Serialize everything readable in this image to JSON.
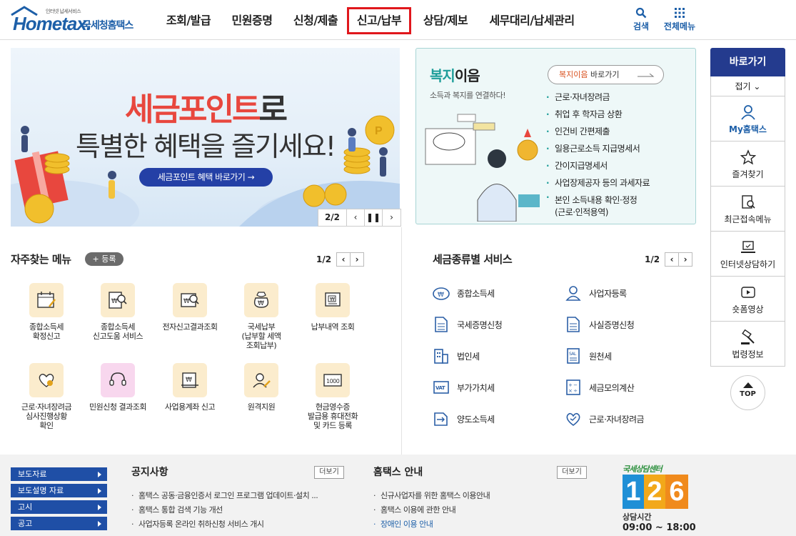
{
  "header": {
    "logo_small": "인터넷 납세서비스",
    "logo_word": "Hometax.",
    "logo_kr": "국세청홈택스",
    "nav": [
      "조회/발급",
      "민원증명",
      "신청/제출",
      "신고/납부",
      "상담/제보",
      "세무대리/납세관리"
    ],
    "active_nav": "신고/납부",
    "search_label": "검색",
    "allmenu_label": "전체메뉴"
  },
  "banner": {
    "title_red": "세금포인트",
    "title_rest": "로",
    "subtitle": "특별한 혜택을 즐기세요!",
    "cta": "세금포인트 혜택 바로가기 →",
    "page": "2/2"
  },
  "welfare": {
    "title_accent": "복지",
    "title_rest": "이음",
    "subtitle": "소득과 복지를 연결하다!",
    "button_accent": "복지이음",
    "button_rest": " 바로가기",
    "items": [
      "근로·자녀장려금",
      "취업 후 학자금 상환",
      "인건비 간편제출",
      "일용근로소득 지급명세서",
      "간이지급명세서",
      "사업장제공자 등의 과세자료",
      "본인 소득내용 확인·정정",
      "(근로·인적용역)"
    ]
  },
  "quick": {
    "title": "바로가기",
    "fold": "접기",
    "items": [
      "My홈택스",
      "즐겨찾기",
      "최근접속메뉴",
      "인터넷상담하기",
      "숏폼영상",
      "법령정보"
    ],
    "top": "TOP"
  },
  "frequent": {
    "title": "자주찾는 메뉴",
    "register": "+ 등록",
    "page": "1/2",
    "items": [
      {
        "label": "종합소득세\n확정신고",
        "icon": "calendar-icon"
      },
      {
        "label": "종합소득세\n신고도움 서비스",
        "icon": "doc-search-icon"
      },
      {
        "label": "전자신고결과조회",
        "icon": "doc-search-icon"
      },
      {
        "label": "국세납부\n(납부할 세액\n조회납부)",
        "icon": "money-bag-icon"
      },
      {
        "label": "납부내역 조회",
        "icon": "receipt-icon"
      },
      {
        "label": "근로·자녀장려금\n심사진행상황\n확인",
        "icon": "heart-hand-icon"
      },
      {
        "label": "민원신청 결과조회",
        "icon": "headset-icon"
      },
      {
        "label": "사업용계좌 신고",
        "icon": "bankbook-icon"
      },
      {
        "label": "원격지원",
        "icon": "support-icon"
      },
      {
        "label": "현금영수증\n발급용 휴대전화\n및 카드 등록",
        "icon": "card-icon"
      }
    ]
  },
  "taxservice": {
    "title": "세금종류별 서비스",
    "page": "1/2",
    "items": [
      {
        "label": "종합소득세",
        "icon": "income-tax-icon"
      },
      {
        "label": "사업자등록",
        "icon": "person-icon"
      },
      {
        "label": "국세증명신청",
        "icon": "doc-icon"
      },
      {
        "label": "사실증명신청",
        "icon": "doc-icon"
      },
      {
        "label": "법인세",
        "icon": "building-icon"
      },
      {
        "label": "원천세",
        "icon": "salary-icon"
      },
      {
        "label": "부가가치세",
        "icon": "vat-icon"
      },
      {
        "label": "세금모의계산",
        "icon": "calculator-icon"
      },
      {
        "label": "양도소득세",
        "icon": "transfer-icon"
      },
      {
        "label": "근로·자녀장려금",
        "icon": "heart-hand-icon"
      }
    ]
  },
  "footer": {
    "buttons": [
      "보도자료",
      "보도설명 자료",
      "고시",
      "공고"
    ],
    "notice_title": "공지사항",
    "notice_more": "더보기",
    "notices": [
      "홈택스 공동·금융인증서 로그인 프로그램 업데이트·설치 ...",
      "홈택스 통합 검색 기능 개선",
      "사업자등록 온라인 취하신청 서비스 개시"
    ],
    "guide_title": "홈택스 안내",
    "guide_more": "더보기",
    "guides": [
      "신규사업자를 위한 홈택스 이용안내",
      "홈택스 이용에 관한 안내",
      "장애인 이용 안내"
    ],
    "call_title": "국세상담센터",
    "call_number": "126",
    "call_hours_label": "상담시간",
    "call_hours": "09:00 ~ 18:00"
  },
  "colors": {
    "brand": "#1d5fa8",
    "quick_head": "#243b8e",
    "highlight": "#e0171c",
    "footer_btn": "#1f4fa6"
  }
}
